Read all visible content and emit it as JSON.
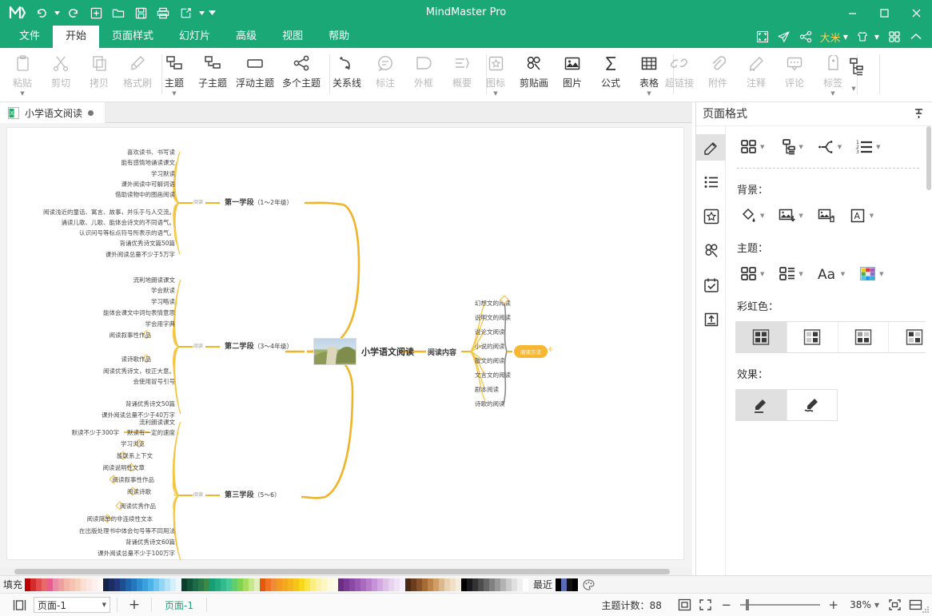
{
  "window": {
    "title": "MindMaster Pro"
  },
  "quick_access": [
    "undo-icon",
    "redo-icon",
    "new-icon",
    "open-icon",
    "save-icon",
    "print-icon",
    "export-icon",
    "more-icon"
  ],
  "window_controls": {
    "minimize": "–",
    "maximize": "□",
    "close": "✕"
  },
  "menu": {
    "items": [
      {
        "label": "文件",
        "active": false
      },
      {
        "label": "开始",
        "active": true
      },
      {
        "label": "页面样式",
        "active": false
      },
      {
        "label": "幻灯片",
        "active": false
      },
      {
        "label": "高级",
        "active": false
      },
      {
        "label": "视图",
        "active": false
      },
      {
        "label": "帮助",
        "active": false
      }
    ],
    "right": {
      "user": "大米",
      "icons": [
        "fullscreen-icon",
        "send-icon",
        "share-icon",
        "theme-icon",
        "apps-icon",
        "collapse-icon"
      ]
    }
  },
  "ribbon": {
    "groups": [
      {
        "name": "clipboard",
        "items": [
          {
            "label": "粘贴",
            "icon": "paste-icon",
            "dim": true,
            "dropdown": true
          },
          {
            "label": "剪切",
            "icon": "cut-icon",
            "dim": true,
            "dropdown": false
          },
          {
            "label": "拷贝",
            "icon": "copy-icon",
            "dim": true,
            "dropdown": false
          },
          {
            "label": "格式刷",
            "icon": "format-painter-icon",
            "dim": true,
            "dropdown": false
          }
        ]
      },
      {
        "name": "topics",
        "items": [
          {
            "label": "主题",
            "icon": "topic-icon",
            "dim": false,
            "dropdown": true
          },
          {
            "label": "子主题",
            "icon": "subtopic-icon",
            "dim": false,
            "dropdown": false
          },
          {
            "label": "浮动主题",
            "icon": "floating-topic-icon",
            "dim": false,
            "dropdown": false
          },
          {
            "label": "多个主题",
            "icon": "multi-topic-icon",
            "dim": false,
            "dropdown": false
          }
        ]
      },
      {
        "name": "relations",
        "items": [
          {
            "label": "关系线",
            "icon": "relationship-line-icon",
            "dim": false,
            "dropdown": false
          },
          {
            "label": "标注",
            "icon": "callout-icon",
            "dim": true,
            "dropdown": false
          },
          {
            "label": "外框",
            "icon": "boundary-icon",
            "dim": true,
            "dropdown": false
          },
          {
            "label": "概要",
            "icon": "summary-icon",
            "dim": true,
            "dropdown": false
          }
        ]
      },
      {
        "name": "insert",
        "items": [
          {
            "label": "图标",
            "icon": "marker-icon",
            "dim": true,
            "dropdown": true
          },
          {
            "label": "剪贴画",
            "icon": "clipart-icon",
            "dim": false,
            "dropdown": false
          },
          {
            "label": "图片",
            "icon": "image-icon",
            "dim": false,
            "dropdown": false
          },
          {
            "label": "公式",
            "icon": "formula-icon",
            "dim": false,
            "dropdown": false
          },
          {
            "label": "表格",
            "icon": "table-icon",
            "dim": false,
            "dropdown": true
          }
        ]
      },
      {
        "name": "attach",
        "items": [
          {
            "label": "超链接",
            "icon": "hyperlink-icon",
            "dim": true,
            "dropdown": false
          },
          {
            "label": "附件",
            "icon": "attachment-icon",
            "dim": true,
            "dropdown": false
          },
          {
            "label": "注释",
            "icon": "note-icon",
            "dim": true,
            "dropdown": false
          },
          {
            "label": "评论",
            "icon": "comment-icon",
            "dim": true,
            "dropdown": false
          },
          {
            "label": "标签",
            "icon": "tag-icon",
            "dim": true,
            "dropdown": true
          }
        ]
      },
      {
        "name": "structure",
        "items": [
          {
            "label": "",
            "icon": "structure-icon",
            "dim": false,
            "dropdown": true
          }
        ]
      }
    ]
  },
  "doc_tab": {
    "title": "小学语文阅读",
    "icon": "document-icon",
    "modified": true
  },
  "mindmap": {
    "center": {
      "label": "小学语文阅读",
      "image": "landscape-photo"
    },
    "left_branches": [
      {
        "connector_label": "阅读",
        "stage": "第一学段",
        "years": "（1～2年级）",
        "leaves": [
          {
            "text": "喜欢读书、书写读",
            "marker": "none"
          },
          {
            "text": "能有感情地诵读课文",
            "marker": "none"
          },
          {
            "text": "学习默读",
            "marker": "none"
          },
          {
            "text": "课外阅读中可解词语",
            "marker": "none"
          },
          {
            "text": "借助读物中的图画阅读",
            "marker": "none"
          },
          {
            "text": "阅读浅近的童话、寓言、故事，并乐于与人交流。",
            "marker": "none"
          },
          {
            "text": "诵读儿歌、儿歌、能体会诗文的不同语气。",
            "marker": "none"
          },
          {
            "text": "认识问号等标点符号所表示的语气。",
            "marker": "none"
          },
          {
            "text": "背诵优秀诗文篇50篇",
            "marker": "none"
          },
          {
            "text": "课外阅读总量不少于5万字",
            "marker": "none"
          }
        ]
      },
      {
        "connector_label": "阅读",
        "stage": "第二学段",
        "years": "（3～4年级）",
        "leaves": [
          {
            "text": "流利地朗读课文",
            "marker": "none"
          },
          {
            "text": "学会默读",
            "marker": "none"
          },
          {
            "text": "学习略读",
            "marker": "none"
          },
          {
            "text": "能体会课文中词句表情意思",
            "marker": "none"
          },
          {
            "text": "学会用字典",
            "marker": "none"
          },
          {
            "text": "阅读叙事性作品",
            "marker": "hollow"
          },
          {
            "text": "读诗歌作品",
            "marker": "hollow"
          },
          {
            "text": "阅读优秀诗文，校正大意。",
            "marker": "none"
          },
          {
            "text": "会使用冒号引号",
            "marker": "none"
          },
          {
            "text": "背诵优秀诗文50篇",
            "marker": "none"
          },
          {
            "text": "课外阅读总量不少于40万字",
            "marker": "none"
          }
        ]
      },
      {
        "connector_label": "阅读",
        "stage": "第三学段",
        "years": "（5～6）",
        "leaves": [
          {
            "text": "流利朗读课文",
            "marker": "none"
          },
          {
            "text": "默读有一定的速度",
            "marker": "none",
            "sub": "默读不少于300字"
          },
          {
            "text": "学习浏览",
            "marker": "hollow"
          },
          {
            "text": "能联系上下文",
            "marker": "hollow"
          },
          {
            "text": "阅读说明性文章",
            "marker": "hollow"
          },
          {
            "text": "阅读叙事性作品",
            "marker": "hollow"
          },
          {
            "text": "阅读诗歌",
            "marker": "hollow"
          },
          {
            "text": "阅读优秀作品",
            "marker": "hollow"
          },
          {
            "text": "阅读简单的非连续性文本",
            "marker": "hollow"
          },
          {
            "text": "在出版处理书中体会句号等不同用法",
            "marker": "none"
          },
          {
            "text": "背诵优秀诗文60篇",
            "marker": "none"
          },
          {
            "text": "课外阅读总量不少于100万字",
            "marker": "none"
          }
        ]
      }
    ],
    "right_branch": {
      "label": "阅读内容",
      "leaves": [
        {
          "text": "幻想文的阅读"
        },
        {
          "text": "说明文的阅读"
        },
        {
          "text": "说论文阅读"
        },
        {
          "text": "小说的阅读"
        },
        {
          "text": "散文的阅读"
        },
        {
          "text": "文言文的阅读"
        },
        {
          "text": "剧本阅读"
        },
        {
          "text": "诗歌的阅读"
        }
      ],
      "pill": "阅读方法"
    }
  },
  "right_panel": {
    "title": "页面格式",
    "pin_icon": "pin-icon",
    "rail": [
      {
        "icon": "page-format-icon",
        "active": true
      },
      {
        "icon": "outline-icon",
        "active": false
      },
      {
        "icon": "marker-panel-icon",
        "active": false
      },
      {
        "icon": "clipart-panel-icon",
        "active": false
      },
      {
        "icon": "task-panel-icon",
        "active": false
      },
      {
        "icon": "export-panel-icon",
        "active": false
      }
    ],
    "top_row": [
      {
        "icon": "layout-icon",
        "dropdown": true
      },
      {
        "icon": "structure-icon",
        "dropdown": true
      },
      {
        "icon": "branch-style-icon",
        "dropdown": true
      },
      {
        "icon": "numbering-icon",
        "dropdown": true
      }
    ],
    "background": {
      "title": "背景：",
      "items": [
        {
          "icon": "fill-color-icon",
          "dropdown": true
        },
        {
          "icon": "insert-background-image-icon",
          "dropdown": true
        },
        {
          "icon": "delete-background-image-icon",
          "dropdown": false
        },
        {
          "icon": "watermark-icon",
          "dropdown": true
        }
      ]
    },
    "theme": {
      "title": "主题：",
      "items": [
        {
          "icon": "theme-layout-icon",
          "dropdown": true
        },
        {
          "icon": "theme-style-icon",
          "dropdown": true
        },
        {
          "icon": "theme-font-icon",
          "dropdown": true
        },
        {
          "icon": "theme-color-icon",
          "dropdown": true
        }
      ]
    },
    "rainbow": {
      "title": "彩虹色：",
      "options": [
        {
          "icon": "rainbow-opt-1",
          "active": true
        },
        {
          "icon": "rainbow-opt-2",
          "active": false
        },
        {
          "icon": "rainbow-opt-3",
          "active": false
        },
        {
          "icon": "rainbow-opt-4",
          "active": false
        }
      ]
    },
    "effect": {
      "title": "效果：",
      "options": [
        {
          "icon": "pencil-straight-icon",
          "active": true
        },
        {
          "icon": "pencil-hand-drawn-icon",
          "active": false
        }
      ]
    }
  },
  "palette_bar": {
    "fill_label": "填充",
    "recent_label": "最近",
    "colors": [
      "#c00000",
      "#d42c2c",
      "#e04b4b",
      "#e76a6a",
      "#ec5a8f",
      "#e98ca6",
      "#ef9f9f",
      "#f3b4aa",
      "#f5c2ad",
      "#f7d0bb",
      "#fadfd3",
      "#fbe8e4",
      "#fdf1f0",
      "#fdf6f6",
      "#12234a",
      "#1b2d63",
      "#23357d",
      "#1c4f8f",
      "#1f63a8",
      "#2577bd",
      "#2f8ccf",
      "#3ba0de",
      "#4bb5e8",
      "#6ec5ef",
      "#93d5f4",
      "#b6e3f7",
      "#d6effa",
      "#eaf7fd",
      "#0c3f2a",
      "#12553a",
      "#1a6b4a",
      "#2a7a48",
      "#3b8a46",
      "#179e74",
      "#23ab7f",
      "#2fbb8c",
      "#46c79a",
      "#5ecf6a",
      "#7fd34e",
      "#a7dd5f",
      "#c6e78b",
      "#dff0bd",
      "#e8580c",
      "#ef7320",
      "#f08b3a",
      "#f39a22",
      "#f4a81e",
      "#f5b61b",
      "#f7c51a",
      "#f8d818",
      "#fbe646",
      "#fbee80",
      "#fcf3a8",
      "#fdf6c4",
      "#fdf9dc",
      "#fefce9",
      "#6a2c84",
      "#7a3a95",
      "#8a49a4",
      "#9a58b3",
      "#a96ac0",
      "#b87ecb",
      "#c694d6",
      "#d2a9e0",
      "#ddbfe8",
      "#e7d2f0",
      "#f0e2f6",
      "#f6eefa",
      "#4a2a14",
      "#6b3d1e",
      "#8a5228",
      "#a66b35",
      "#bf8448",
      "#cf9e66",
      "#dcb98c",
      "#e8d2b1",
      "#efe1c9",
      "#f4ecdc",
      "#000000",
      "#1a1a1a",
      "#333333",
      "#4d4d4d",
      "#666666",
      "#808080",
      "#999999",
      "#b3b3b3",
      "#cccccc",
      "#e0e0e0",
      "#f0f0f0",
      "#ffffff"
    ],
    "recent_colors": [
      "#000000",
      "#5b6bb5",
      "#111111",
      "#000000"
    ],
    "palette_icon": "palette-icon"
  },
  "status_bar": {
    "view_icon": "page-view-icon",
    "page_select": "页面-1",
    "add_page_icon": "plus-icon",
    "page_tab": "页面-1",
    "topic_count_label": "主题计数：",
    "topic_count": "88",
    "zoom_value": "38%",
    "zoom_minus": "−",
    "zoom_plus": "+",
    "icons": [
      "fit-selection-icon",
      "fit-page-icon",
      "zoom-reset-icon",
      "split-view-icon"
    ]
  }
}
